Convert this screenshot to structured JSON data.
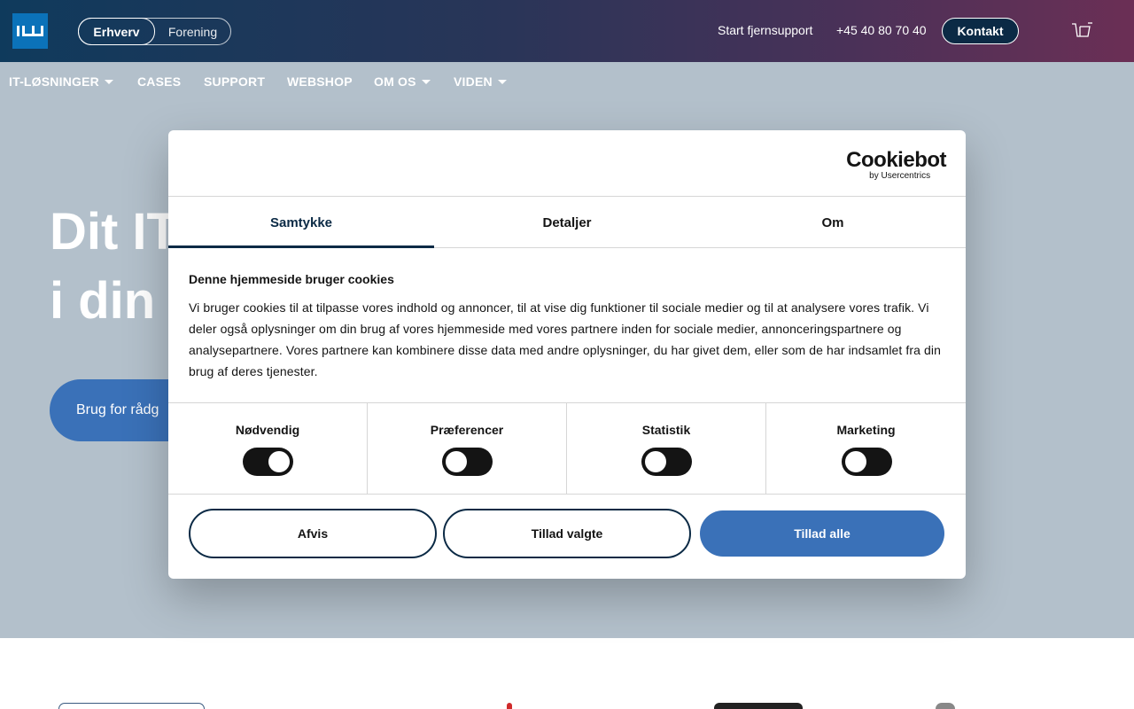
{
  "header": {
    "segments": [
      {
        "label": "Erhverv",
        "active": true
      },
      {
        "label": "Forening",
        "active": false
      }
    ],
    "support_link": "Start fjernsupport",
    "phone": "+45 40 80 70 40",
    "contact_button": "Kontakt"
  },
  "nav": {
    "items": [
      {
        "label": "IT-LØSNINGER",
        "dropdown": true
      },
      {
        "label": "CASES",
        "dropdown": false
      },
      {
        "label": "SUPPORT",
        "dropdown": false
      },
      {
        "label": "WEBSHOP",
        "dropdown": false
      },
      {
        "label": "OM OS",
        "dropdown": true
      },
      {
        "label": "VIDEN",
        "dropdown": true
      }
    ]
  },
  "hero": {
    "line1": "Dit IT",
    "line2": "i din v",
    "cta": "Brug for rådg"
  },
  "cookie_dialog": {
    "brand": "Cookiebot",
    "brand_sub": "by Usercentrics",
    "tabs": [
      {
        "label": "Samtykke",
        "active": true
      },
      {
        "label": "Detaljer",
        "active": false
      },
      {
        "label": "Om",
        "active": false
      }
    ],
    "title": "Denne hjemmeside bruger cookies",
    "text": "Vi bruger cookies til at tilpasse vores indhold og annoncer, til at vise dig funktioner til sociale medier og til at analysere vores trafik. Vi deler også oplysninger om din brug af vores hjemmeside med vores partnere inden for sociale medier, annonceringspartnere og analysepartnere. Vores partnere kan kombinere disse data med andre oplysninger, du har givet dem, eller som de har indsamlet fra din brug af deres tjenester.",
    "toggles": [
      {
        "label": "Nødvendig",
        "on": true
      },
      {
        "label": "Præferencer",
        "on": false
      },
      {
        "label": "Statistik",
        "on": false
      },
      {
        "label": "Marketing",
        "on": false
      }
    ],
    "buttons": {
      "reject": "Afvis",
      "allow_selected": "Tillad valgte",
      "allow_all": "Tillad alle"
    }
  },
  "colors": {
    "primary_dark": "#0b2a45",
    "accent_blue": "#3a71b8",
    "logo_blue": "#0b72b9",
    "hero_overlay": "#b3c0cb"
  }
}
